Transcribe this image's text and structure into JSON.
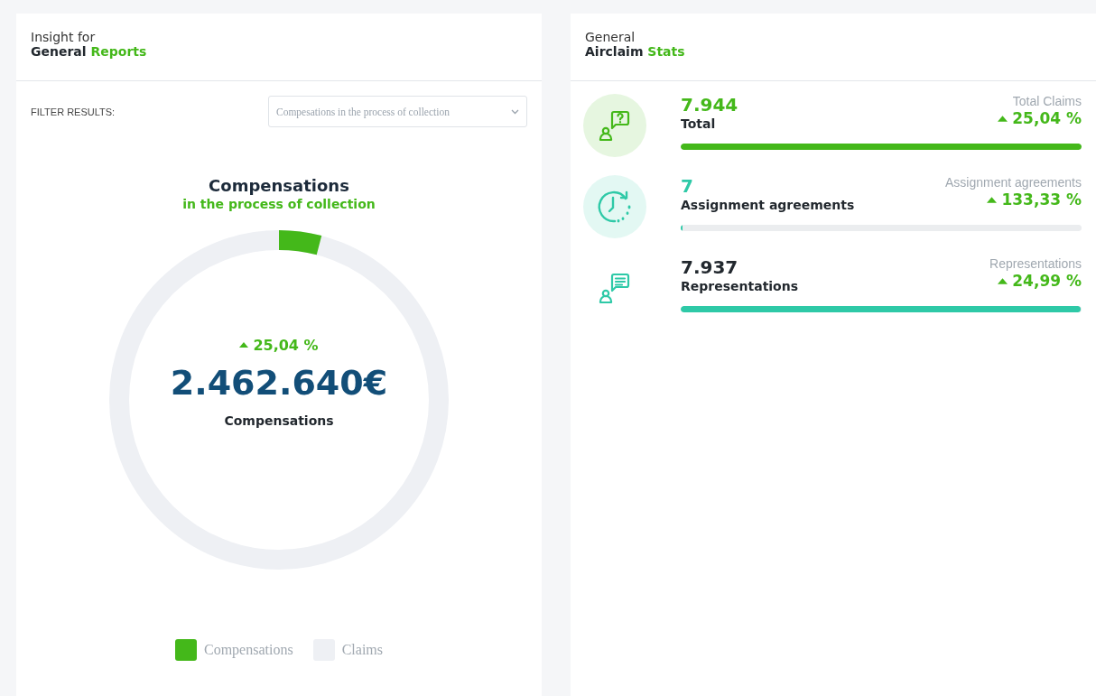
{
  "reports": {
    "title_top": "Insight for",
    "title_bold": "General",
    "title_accent": "Reports",
    "filter": {
      "label": "FILTER RESULTS:",
      "value": "Compesations in the process of collection"
    },
    "chart_title": "Compensations",
    "chart_subtitle": "in the process of collection",
    "change": "25,04 %",
    "amount": "2.462.640€",
    "amount_label": "Compensations",
    "legend": [
      {
        "label": "Compensations",
        "color": "#44b81a"
      },
      {
        "label": "Claims",
        "color": "#eef0f4"
      }
    ]
  },
  "stats": {
    "title_top": "General",
    "title_bold": "Airclaim",
    "title_accent": "Stats",
    "items": [
      {
        "kind": "question",
        "color": "#44b81a",
        "highlighted": true,
        "icon_backdrop": true,
        "value": "7.944",
        "name": "Total",
        "caption": "Total Claims",
        "change": "25,04 %",
        "level": 1
      },
      {
        "kind": "clock",
        "color": "#2ec9a7",
        "highlighted": true,
        "icon_backdrop": true,
        "value": "7",
        "name": "Assignment agreements",
        "caption": "Assignment agreements",
        "change": "133,33 %",
        "level": 0.005
      },
      {
        "kind": "document",
        "color": "#2ec9a7",
        "highlighted": false,
        "icon_backdrop": false,
        "value": "7.937",
        "name": "Representations",
        "caption": "Representations",
        "change": "24,99 %",
        "level": 0.998
      }
    ]
  }
}
